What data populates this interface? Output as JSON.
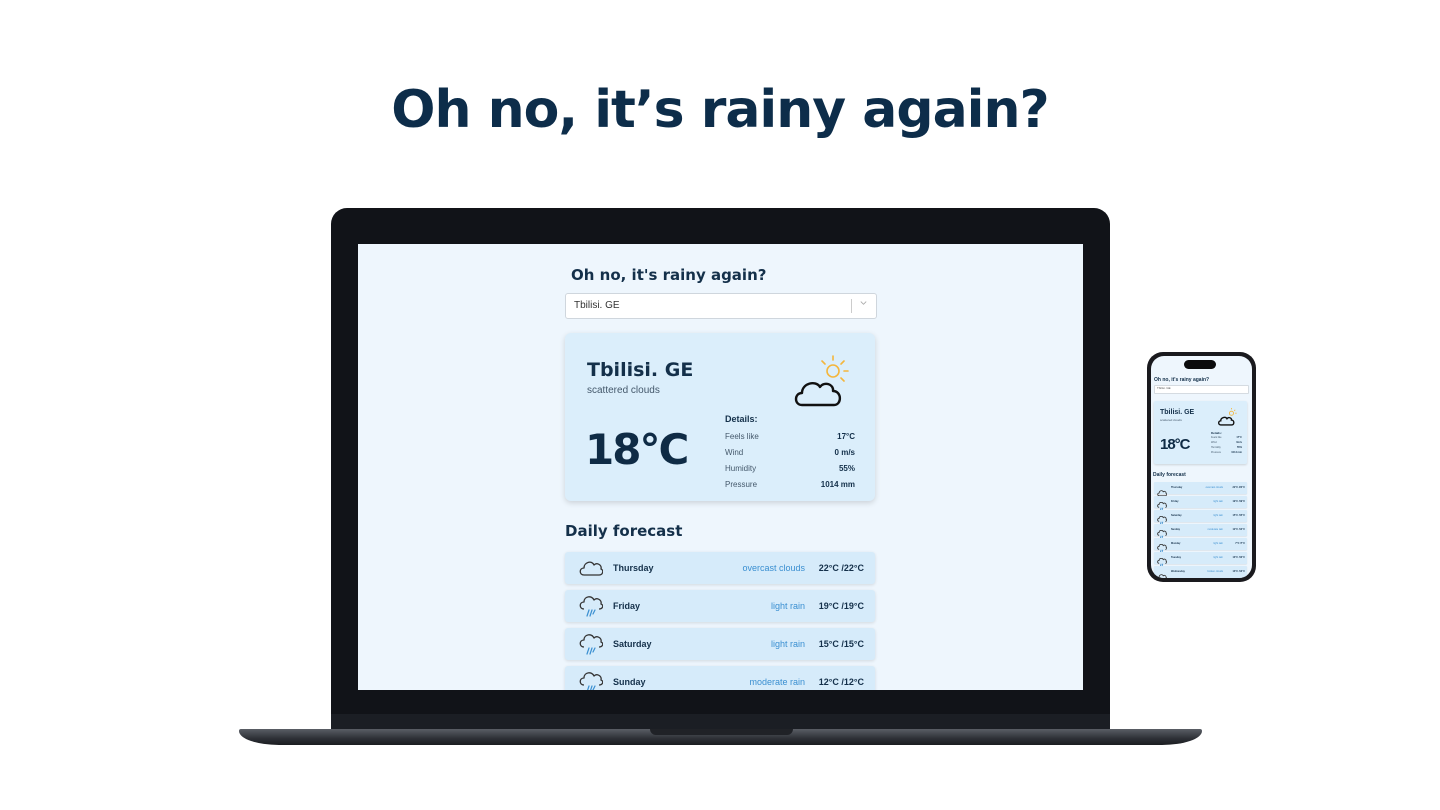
{
  "hero": {
    "title": "Oh no, it’s rainy again?"
  },
  "app": {
    "title": "Oh no, it's rainy again?",
    "city_select": {
      "value": "Tbilisi. GE"
    },
    "current": {
      "city": "Tbilisi. GE",
      "description": "scattered clouds",
      "temperature": "18°C",
      "icon": "cloud-sun-icon",
      "details_title": "Details:",
      "details": [
        {
          "label": "Feels like",
          "value": "17°C"
        },
        {
          "label": "Wind",
          "value": "0 m/s"
        },
        {
          "label": "Humidity",
          "value": "55%"
        },
        {
          "label": "Pressure",
          "value": "1014 mm"
        }
      ]
    },
    "forecast_title": "Daily forecast",
    "forecast": [
      {
        "day": "Thursday",
        "description": "overcast clouds",
        "temps": "22°C /22°C",
        "icon": "cloud-icon"
      },
      {
        "day": "Friday",
        "description": "light rain",
        "temps": "19°C /19°C",
        "icon": "rain-icon"
      },
      {
        "day": "Saturday",
        "description": "light rain",
        "temps": "15°C /15°C",
        "icon": "rain-icon"
      },
      {
        "day": "Sunday",
        "description": "moderate rain",
        "temps": "12°C /12°C",
        "icon": "rain-icon"
      }
    ]
  },
  "phone": {
    "title": "Oh no, it's rainy again?",
    "city_select": {
      "value": "Tbilisi. GE"
    },
    "current": {
      "city": "Tbilisi. GE",
      "description": "scattered clouds",
      "temperature": "18°C",
      "details_title": "Details:",
      "details": [
        {
          "label": "Feels like",
          "value": "17°C"
        },
        {
          "label": "Wind",
          "value": "0m/s"
        },
        {
          "label": "Humidity",
          "value": "55%"
        },
        {
          "label": "Pressure",
          "value": "1014 mm"
        }
      ]
    },
    "forecast_title": "Daily forecast",
    "forecast": [
      {
        "day": "Thursday",
        "description": "overcast clouds",
        "temps": "22°C /22°C"
      },
      {
        "day": "Friday",
        "description": "light rain",
        "temps": "19°C /19°C"
      },
      {
        "day": "Saturday",
        "description": "light rain",
        "temps": "15°C /15°C"
      },
      {
        "day": "Sunday",
        "description": "moderate rain",
        "temps": "12°C /12°C"
      },
      {
        "day": "Monday",
        "description": "light rain",
        "temps": "7°C /7°C"
      },
      {
        "day": "Tuesday",
        "description": "light rain",
        "temps": "10°C /10°C"
      },
      {
        "day": "Wednesday",
        "description": "broken clouds",
        "temps": "13°C /13°C"
      }
    ]
  },
  "colors": {
    "accent": "#3a8fd1",
    "heading": "#0d2d4a",
    "card": "#dbeefb",
    "background": "#eef6fd"
  }
}
